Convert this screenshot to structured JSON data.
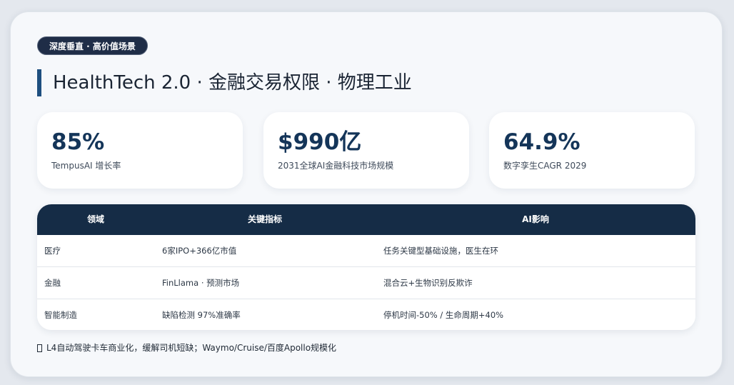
{
  "badge": "深度垂直 · 高价值场景",
  "title": "HealthTech 2.0 · 金融交易权限 · 物理工业",
  "stats": [
    {
      "value": "85%",
      "label": "TempusAI 增长率"
    },
    {
      "value": "$990亿",
      "label": "2031全球AI金融科技市场规模"
    },
    {
      "value": "64.9%",
      "label": "数字孪生CAGR 2029"
    }
  ],
  "table": {
    "headers": [
      "领域",
      "关键指标",
      "AI影响"
    ],
    "rows": [
      {
        "domain": "医疗",
        "metric": "6家IPO+366亿市值",
        "impact": "任务关键型基础设施，医生在环"
      },
      {
        "domain": "金融",
        "metric": "FinLlama · 预测市场",
        "impact": "混合云+生物识别反欺诈"
      },
      {
        "domain": "智能制造",
        "metric": "缺陷检测 97%准确率",
        "impact": "停机时间-50% / 生命周期+40%"
      }
    ]
  },
  "footnote": {
    "icon": "truck-icon",
    "text": "L4自动驾驶卡车商业化，缓解司机短缺；Waymo/Cruise/百度Apollo规模化"
  },
  "colors": {
    "background": "#e4e8ee",
    "card": "#f6f8fb",
    "accent": "#1e4f7f",
    "header_bg": "#152c46",
    "stat_value": "#143559",
    "badge_bg": "#1f2d47"
  }
}
